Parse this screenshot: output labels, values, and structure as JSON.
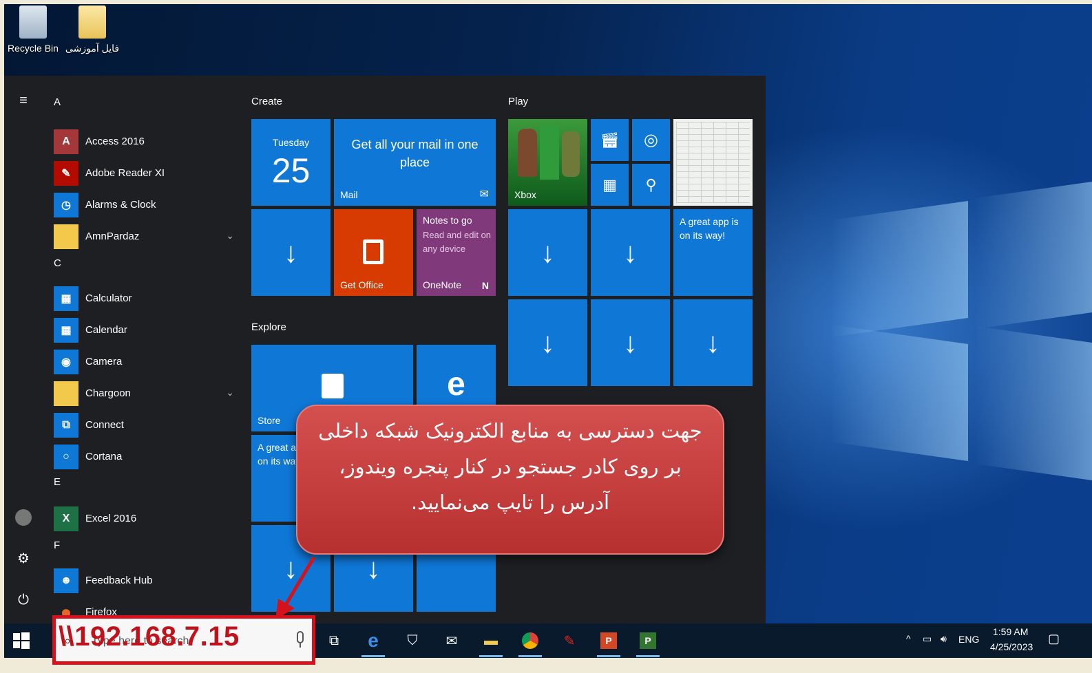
{
  "desktop": {
    "icons": [
      {
        "label": "Recycle Bin",
        "icon": "recycle-bin-icon"
      },
      {
        "label": "فایل آموزشی",
        "icon": "folder-icon"
      }
    ]
  },
  "start_menu": {
    "app_list": {
      "letters": [
        "A",
        "C",
        "E",
        "F"
      ],
      "apps": [
        {
          "label": "Access 2016",
          "icon": "access-icon",
          "icon_text": "A",
          "color": "#a4373a"
        },
        {
          "label": "Adobe Reader XI",
          "icon": "adobe-reader-icon",
          "icon_text": "✎",
          "color": "#b30b00"
        },
        {
          "label": "Alarms & Clock",
          "icon": "alarm-clock-icon",
          "icon_text": "◷",
          "color": "#0f78d7"
        },
        {
          "label": "AmnPardaz",
          "icon": "folder-icon",
          "icon_text": "",
          "color": "#f3c94c",
          "expandable": true
        },
        {
          "label": "Calculator",
          "icon": "calculator-icon",
          "icon_text": "▦",
          "color": "#0f78d7"
        },
        {
          "label": "Calendar",
          "icon": "calendar-icon",
          "icon_text": "▦",
          "color": "#0f78d7"
        },
        {
          "label": "Camera",
          "icon": "camera-icon",
          "icon_text": "◉",
          "color": "#0f78d7"
        },
        {
          "label": "Chargoon",
          "icon": "folder-icon",
          "icon_text": "",
          "color": "#f3c94c",
          "expandable": true
        },
        {
          "label": "Connect",
          "icon": "connect-icon",
          "icon_text": "⧉",
          "color": "#0f78d7"
        },
        {
          "label": "Cortana",
          "icon": "cortana-icon",
          "icon_text": "○",
          "color": "#0f78d7"
        },
        {
          "label": "Excel 2016",
          "icon": "excel-icon",
          "icon_text": "X",
          "color": "#1e7145"
        },
        {
          "label": "Feedback Hub",
          "icon": "feedback-hub-icon",
          "icon_text": "☻",
          "color": "#0f78d7"
        },
        {
          "label": "Firefox",
          "icon": "firefox-icon",
          "icon_text": "●",
          "color": "#e8662a"
        }
      ]
    },
    "groups": {
      "create": "Create",
      "play": "Play",
      "explore": "Explore"
    },
    "tiles": {
      "calendar_day": "Tuesday",
      "calendar_date": "25",
      "mail_text": "Get all your mail in one place",
      "mail_name": "Mail",
      "get_office": "Get Office",
      "onenote_title": "Notes to go",
      "onenote_sub": "Read and edit on any device",
      "onenote_name": "OneNote",
      "xbox_name": "Xbox",
      "great_app": "A great app is on its way!",
      "store_name": "Store",
      "great_app_partial": "A great app is on its way!",
      "download_glyph": "↓"
    }
  },
  "callout": {
    "text": "جهت دسترسی به منابع الکترونیک شبکه داخلی بر روی کادر جستجو در کنار پنجره ویندوز، آدرس را تایپ می‌نمایید."
  },
  "taskbar": {
    "search_placeholder": "Type here to search",
    "typed_address": "\\\\192.168.7.15",
    "tray": {
      "language": "ENG",
      "time": "1:59 AM",
      "date": "4/25/2023"
    }
  },
  "colors": {
    "tile_blue": "#0f78d7",
    "office_orange": "#d83b01",
    "onenote_purple": "#80397b",
    "xbox_green": "#107c10",
    "callout_red": "#c23b3a",
    "highlight_red": "#d5121b"
  }
}
